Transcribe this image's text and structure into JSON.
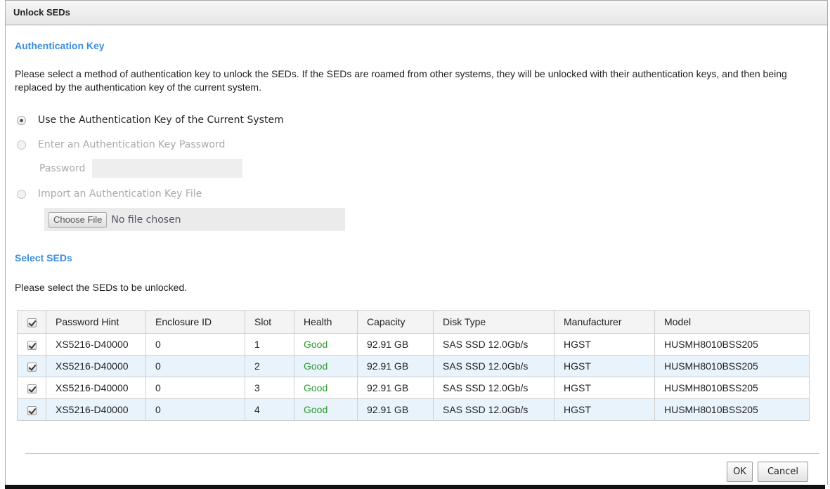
{
  "dialog": {
    "title": "Unlock SEDs"
  },
  "auth": {
    "section_title": "Authentication Key",
    "description": "Please select a method of authentication key to unlock the SEDs. If the SEDs are roamed from other systems, they will be unlocked with their authentication keys, and then being replaced by the authentication key of the current system.",
    "options": [
      {
        "label": "Use the Authentication Key of the Current System",
        "checked": true,
        "disabled": false
      },
      {
        "label": "Enter an Authentication Key Password",
        "checked": false,
        "disabled": true
      },
      {
        "label": "Import an Authentication Key File",
        "checked": false,
        "disabled": true
      }
    ],
    "password_label": "Password",
    "password_value": "",
    "choose_file_label": "Choose File",
    "file_status": "No file chosen"
  },
  "seds": {
    "section_title": "Select SEDs",
    "description": "Please select the SEDs to be unlocked.",
    "select_all_checked": true,
    "columns": [
      "Password Hint",
      "Enclosure ID",
      "Slot",
      "Health",
      "Capacity",
      "Disk Type",
      "Manufacturer",
      "Model"
    ],
    "rows": [
      {
        "checked": true,
        "password_hint": "XS5216-D40000",
        "enclosure_id": "0",
        "slot": "1",
        "health": "Good",
        "capacity": "92.91 GB",
        "disk_type": "SAS SSD 12.0Gb/s",
        "manufacturer": "HGST",
        "model": "HUSMH8010BSS205"
      },
      {
        "checked": true,
        "password_hint": "XS5216-D40000",
        "enclosure_id": "0",
        "slot": "2",
        "health": "Good",
        "capacity": "92.91 GB",
        "disk_type": "SAS SSD 12.0Gb/s",
        "manufacturer": "HGST",
        "model": "HUSMH8010BSS205"
      },
      {
        "checked": true,
        "password_hint": "XS5216-D40000",
        "enclosure_id": "0",
        "slot": "3",
        "health": "Good",
        "capacity": "92.91 GB",
        "disk_type": "SAS SSD 12.0Gb/s",
        "manufacturer": "HGST",
        "model": "HUSMH8010BSS205"
      },
      {
        "checked": true,
        "password_hint": "XS5216-D40000",
        "enclosure_id": "0",
        "slot": "4",
        "health": "Good",
        "capacity": "92.91 GB",
        "disk_type": "SAS SSD 12.0Gb/s",
        "manufacturer": "HGST",
        "model": "HUSMH8010BSS205"
      }
    ]
  },
  "buttons": {
    "ok": "OK",
    "cancel": "Cancel"
  },
  "colors": {
    "section_title": "#3c8dde",
    "health_good": "#2c9a2c",
    "row_alt": "#e9f3fc"
  }
}
